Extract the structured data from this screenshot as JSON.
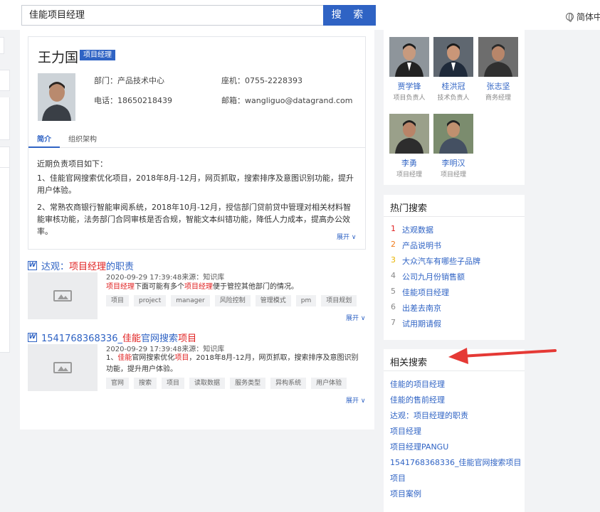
{
  "search": {
    "query": "佳能项目经理",
    "button": "搜 索"
  },
  "language": "简体中文",
  "profile": {
    "name": "王力国",
    "tag": "项目经理",
    "dept": "部门：产品技术中心",
    "seat": "座机：0755-2228393",
    "phone": "电话：18650218439",
    "email": "邮箱：wangliguo@datagrand.com",
    "tabs": [
      "简介",
      "组织架构"
    ],
    "intro_title": "近期负责项目如下：",
    "intro_p1": "1、佳能官网搜索优化项目，2018年8月-12月，网页抓取，搜索排序及意图识别功能，提升用户体验。",
    "intro_p2": "2、常熟农商银行智能审阅系统，2018年10月-12月，授信部门贷前贷中管理对相关材料智能审核功能，法务部门合同审核是否合规，智能文本纠错功能，降低人力成本，提高办公效率。",
    "expand": "展开"
  },
  "results": [
    {
      "title_pre": "达观：",
      "title_hl": "项目经理",
      "title_post": "的职责",
      "meta": "2020-09-29 17:39:48来源：知识库",
      "snippet_parts": [
        {
          "t": "项目经理",
          "hl": true
        },
        {
          "t": "下面可能有多个",
          "hl": false
        },
        {
          "t": "项目经理",
          "hl": true
        },
        {
          "t": "便于管控其他部门的情况。",
          "hl": false
        }
      ],
      "tags": [
        "项目",
        "project",
        "manager",
        "风险控制",
        "管理模式",
        "pm",
        "项目规划"
      ],
      "expand": "展开"
    },
    {
      "title_pre": "1541768368336_",
      "title_hl": "佳能",
      "title_mid": "官网搜索",
      "title_hl2": "项目",
      "meta": "2020-09-29 17:39:48来源：知识库",
      "snippet_parts": [
        {
          "t": "1、",
          "hl": false
        },
        {
          "t": "佳能",
          "hl": true
        },
        {
          "t": "官网搜索优化",
          "hl": false
        },
        {
          "t": "项目",
          "hl": true
        },
        {
          "t": "，2018年8月-12月，网页抓取，搜索排序及意图识别功能，提升用户体验。",
          "hl": false
        }
      ],
      "tags": [
        "官网",
        "搜索",
        "项目",
        "读取数据",
        "服务类型",
        "异构系统",
        "用户体验"
      ],
      "expand": "展开"
    }
  ],
  "people": [
    {
      "name": "贾学锋",
      "role": "项目负责人"
    },
    {
      "name": "桂洪冠",
      "role": "技术负责人"
    },
    {
      "name": "张志坚",
      "role": "商务经理"
    },
    {
      "name": "李勇",
      "role": "项目经理"
    },
    {
      "name": "李明汉",
      "role": "项目经理"
    }
  ],
  "hot": {
    "title": "热门搜索",
    "items": [
      {
        "rank": "1",
        "text": "达观数据",
        "color": "#e02020"
      },
      {
        "rank": "2",
        "text": "产品说明书",
        "color": "#f07a1a"
      },
      {
        "rank": "3",
        "text": "大众汽车有哪些子品牌",
        "color": "#e8b400"
      },
      {
        "rank": "4",
        "text": "公司九月份销售额",
        "color": "#888888"
      },
      {
        "rank": "5",
        "text": "佳能项目经理",
        "color": "#888888"
      },
      {
        "rank": "6",
        "text": "出差去南京",
        "color": "#888888"
      },
      {
        "rank": "7",
        "text": "试用期请假",
        "color": "#888888"
      }
    ]
  },
  "related": {
    "title": "相关搜索",
    "items": [
      "佳能的项目经理",
      "佳能的售前经理",
      "达观：项目经理的职责",
      "项目经理",
      "项目经理PANGU",
      "1541768368336_佳能官网搜索项目",
      "项目",
      "项目案例"
    ]
  },
  "colors": {
    "accent": "#2f63c4",
    "highlight": "#e02020",
    "annotation_arrow": "#e53935"
  }
}
